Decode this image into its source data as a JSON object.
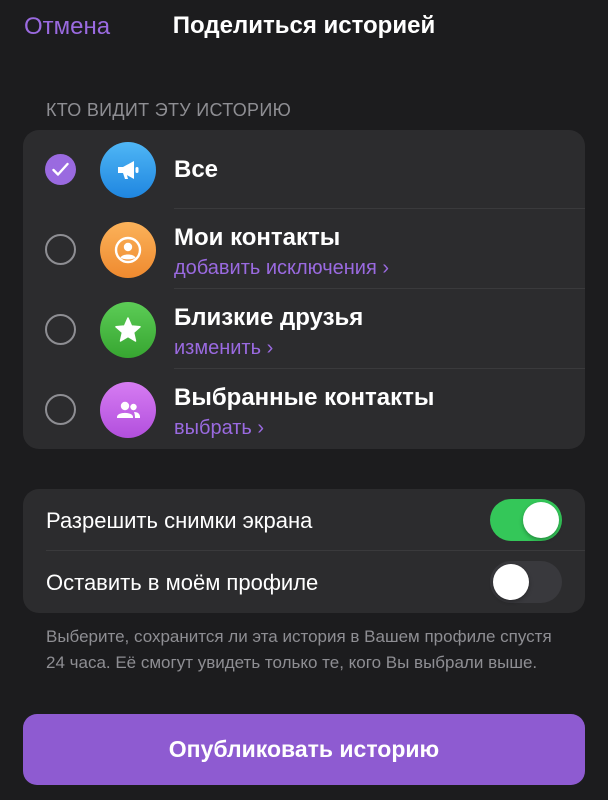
{
  "header": {
    "cancel_label": "Отмена",
    "title": "Поделиться историей"
  },
  "audience": {
    "section_label": "КТО ВИДИТ ЭТУ ИСТОРИЮ",
    "options": [
      {
        "name": "Все",
        "sub": "",
        "selected": true,
        "icon": "megaphone-icon",
        "color": "#2f9cec"
      },
      {
        "name": "Мои контакты",
        "sub": "добавить исключения ›",
        "selected": false,
        "icon": "person-icon",
        "color": "#f49b3f"
      },
      {
        "name": "Близкие друзья",
        "sub": "изменить ›",
        "selected": false,
        "icon": "star-icon",
        "color": "#46b73f"
      },
      {
        "name": "Выбранные контакты",
        "sub": "выбрать ›",
        "selected": false,
        "icon": "group-icon",
        "color": "#c05fe5"
      }
    ]
  },
  "settings": {
    "allow_screenshots": {
      "label": "Разрешить снимки экрана",
      "enabled": true
    },
    "keep_in_profile": {
      "label": "Оставить в моём профиле",
      "enabled": false
    },
    "footnote": "Выберите, сохранится ли эта история в Вашем профиле спустя 24 часа. Её смогут увидеть только те, кого Вы выбрали выше."
  },
  "publish_label": "Опубликовать историю",
  "colors": {
    "accent": "#9a6ae0",
    "background": "#1c1c1e",
    "card": "#2c2c2e",
    "toggle_on": "#34c759",
    "publish_button": "#8e5bd1"
  }
}
